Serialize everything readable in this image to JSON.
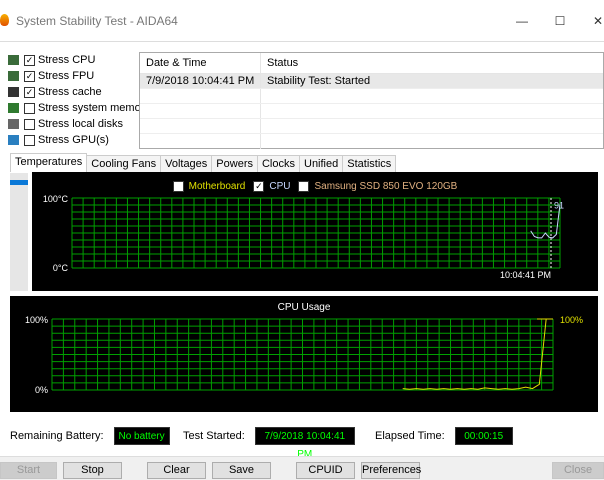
{
  "window": {
    "title": "System Stability Test - AIDA64",
    "minimize": "—",
    "maximize": "☐",
    "close": "✕"
  },
  "options": [
    {
      "label": "Stress CPU",
      "checked": true,
      "icon": "cpu-icon"
    },
    {
      "label": "Stress FPU",
      "checked": true,
      "icon": "fpu-icon"
    },
    {
      "label": "Stress cache",
      "checked": true,
      "icon": "cache-icon"
    },
    {
      "label": "Stress system memory",
      "checked": false,
      "icon": "memory-icon"
    },
    {
      "label": "Stress local disks",
      "checked": false,
      "icon": "disk-icon"
    },
    {
      "label": "Stress GPU(s)",
      "checked": false,
      "icon": "gpu-icon"
    }
  ],
  "log": {
    "headers": [
      "Date & Time",
      "Status"
    ],
    "rows": [
      [
        "7/9/2018 10:04:41 PM",
        "Stability Test: Started"
      ]
    ]
  },
  "tabs": [
    "Temperatures",
    "Cooling Fans",
    "Voltages",
    "Powers",
    "Clocks",
    "Unified",
    "Statistics"
  ],
  "active_tab": "Temperatures",
  "check": "✓",
  "chart_data": [
    {
      "type": "line",
      "title": "",
      "legend": [
        {
          "name": "Motherboard",
          "checked": false,
          "color": "#e0e000"
        },
        {
          "name": "CPU",
          "checked": true,
          "color": "#c8d8ff"
        },
        {
          "name": "Samsung SSD 850 EVO 120GB",
          "checked": false,
          "color": "#e0b080"
        }
      ],
      "ylim": [
        0,
        100
      ],
      "ytick_labels": [
        "100°C",
        "0°C"
      ],
      "x_label": "10:04:41 PM",
      "current_value_label": "91",
      "series": [
        {
          "name": "CPU",
          "values": [
            53,
            45,
            43,
            43,
            50,
            44,
            43,
            48,
            91
          ]
        }
      ],
      "grid": true,
      "grid_color": "#00a000"
    },
    {
      "type": "line",
      "title": "CPU Usage",
      "ylim": [
        0,
        100
      ],
      "ytick_labels": [
        "100%",
        "0%"
      ],
      "current_value_label": "100%",
      "series": [
        {
          "values": [
            2,
            1,
            2,
            1,
            2,
            1,
            2,
            1,
            2,
            1,
            2,
            1,
            3,
            2,
            1,
            2,
            1,
            2,
            4,
            2,
            8,
            100,
            100
          ]
        }
      ],
      "line_color": "#e0e000",
      "grid": true,
      "grid_color": "#00a000"
    }
  ],
  "footer": {
    "battery_label": "Remaining Battery:",
    "battery_value": "No battery",
    "started_label": "Test Started:",
    "started_value": "7/9/2018 10:04:41 PM",
    "elapsed_label": "Elapsed Time:",
    "elapsed_value": "00:00:15"
  },
  "buttons": {
    "start": "Start",
    "stop": "Stop",
    "clear": "Clear",
    "save": "Save",
    "cpuid": "CPUID",
    "preferences": "Preferences",
    "close": "Close"
  }
}
